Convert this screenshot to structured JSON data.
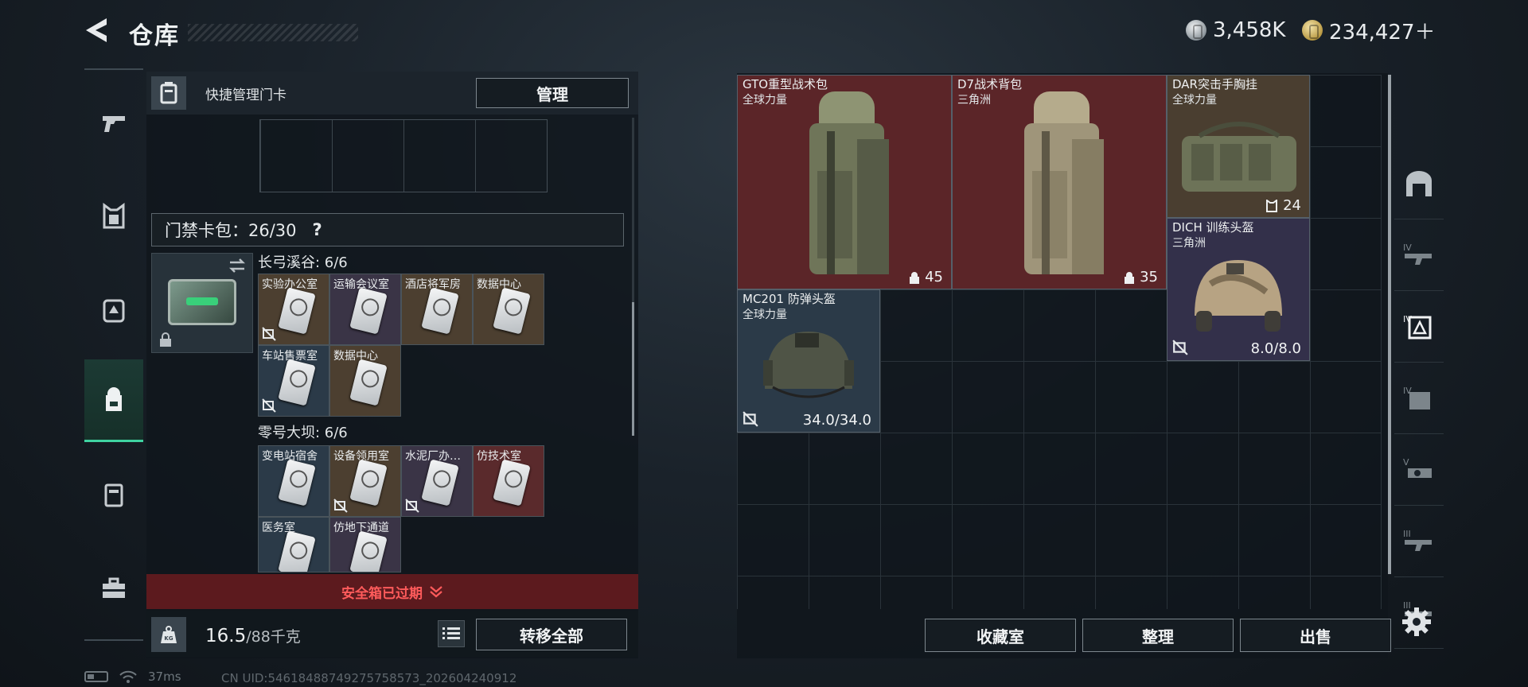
{
  "header": {
    "title": "仓库",
    "currency_silver": "3,458K",
    "currency_gold": "234,427＋"
  },
  "left_nav": {
    "items": [
      "weapons",
      "armor",
      "vest",
      "backpack",
      "safe-box",
      "toolbox"
    ],
    "active_index": 3
  },
  "keycard_panel": {
    "quick_label": "快捷管理门卡",
    "manage_label": "管理",
    "count_label": "门禁卡包：26/30",
    "help": "?",
    "sections": [
      {
        "title": "长弓溪谷: 6/6",
        "cards": [
          {
            "name": "实验办公室",
            "color": "brown",
            "nodrop": true
          },
          {
            "name": "运输会议室",
            "color": "purple",
            "nodrop": false
          },
          {
            "name": "酒店将军房",
            "color": "brown",
            "nodrop": false
          },
          {
            "name": "数据中心",
            "color": "brown",
            "nodrop": false
          },
          {
            "name": "车站售票室",
            "color": "blue",
            "nodrop": true
          },
          {
            "name": "数据中心",
            "color": "brown",
            "nodrop": false
          }
        ]
      },
      {
        "title": "零号大坝: 6/6",
        "cards": [
          {
            "name": "变电站宿舍",
            "color": "blue",
            "nodrop": false
          },
          {
            "name": "设备领用室",
            "color": "brown",
            "nodrop": true
          },
          {
            "name": "水泥厂办…",
            "color": "purple",
            "nodrop": true
          },
          {
            "name": "仿技术室",
            "color": "red",
            "nodrop": false
          },
          {
            "name": "医务室",
            "color": "blue",
            "nodrop": false
          },
          {
            "name": "仿地下通道",
            "color": "purple",
            "nodrop": false
          }
        ]
      }
    ],
    "safe_expired": "安全箱已过期",
    "weight_current": "16.5",
    "weight_capacity": "/88千克",
    "transfer_all": "转移全部"
  },
  "stash": {
    "items": [
      {
        "name": "GTO重型战术包",
        "sub": "全球力量",
        "value": "45",
        "color": "red"
      },
      {
        "name": "D7战术背包",
        "sub": "三角洲",
        "value": "35",
        "color": "red"
      },
      {
        "name": "DAR突击手胸挂",
        "sub": "全球力量",
        "value": "24",
        "color": "brown"
      },
      {
        "name": "DICH 训练头盔",
        "sub": "三角洲",
        "value": "8.0/8.0",
        "color": "purple"
      },
      {
        "name": "MC201 防弹头盔",
        "sub": "全球力量",
        "value": "34.0/34.0",
        "color": "blue"
      }
    ],
    "actions": [
      "收藏室",
      "整理",
      "出售"
    ]
  },
  "right_nav": {
    "tiers": [
      "",
      "IV",
      "IV",
      "IV",
      "V",
      "III",
      "III"
    ],
    "active_index": 2
  },
  "status": {
    "ping": "37ms",
    "uid": "CN UID:54618488749275758573_202604240912"
  }
}
